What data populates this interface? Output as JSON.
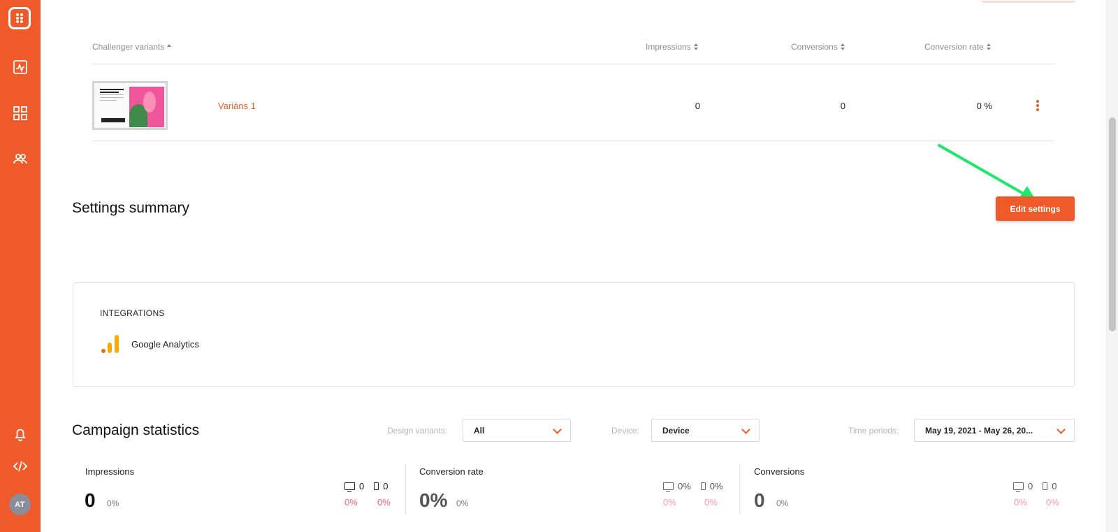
{
  "sidebar": {
    "avatar_initials": "AT",
    "icons": [
      "app-logo-icon",
      "analytics-icon",
      "campaigns-grid-icon",
      "users-icon",
      "bell-icon",
      "code-icon"
    ],
    "brand_color": "#ee5a2a"
  },
  "variants_table": {
    "headers": {
      "variant": "Challenger variants",
      "impressions": "Impressions",
      "conversions": "Conversions",
      "conversion_rate": "Conversion rate"
    },
    "rows": [
      {
        "name": "Variáns 1",
        "impressions": "0",
        "conversions": "0",
        "conversion_rate": "0 %"
      }
    ]
  },
  "settings_summary": {
    "title": "Settings summary",
    "edit_button": "Edit settings",
    "integrations_title": "INTEGRATIONS",
    "integration_name": "Google Analytics"
  },
  "campaign_statistics": {
    "title": "Campaign statistics",
    "filters": {
      "design_variants_label": "Design variants:",
      "design_variants_value": "All",
      "device_label": "Device:",
      "device_value": "Device",
      "time_periods_label": "Time periods:",
      "time_periods_value": "May 19, 2021 - May 26, 20..."
    },
    "stats": [
      {
        "label": "Impressions",
        "value": "0",
        "change": "0%",
        "desktop": "0",
        "mobile": "0",
        "desktop_change": "0%",
        "mobile_change": "0%"
      },
      {
        "label": "Conversion rate",
        "value": "0%",
        "change": "0%",
        "desktop": "0%",
        "mobile": "0%",
        "desktop_change": "0%",
        "mobile_change": "0%"
      },
      {
        "label": "Conversions",
        "value": "0",
        "change": "0%",
        "desktop": "0",
        "mobile": "0",
        "desktop_change": "0%",
        "mobile_change": "0%"
      }
    ]
  },
  "annotation_color": "#1ee86a"
}
